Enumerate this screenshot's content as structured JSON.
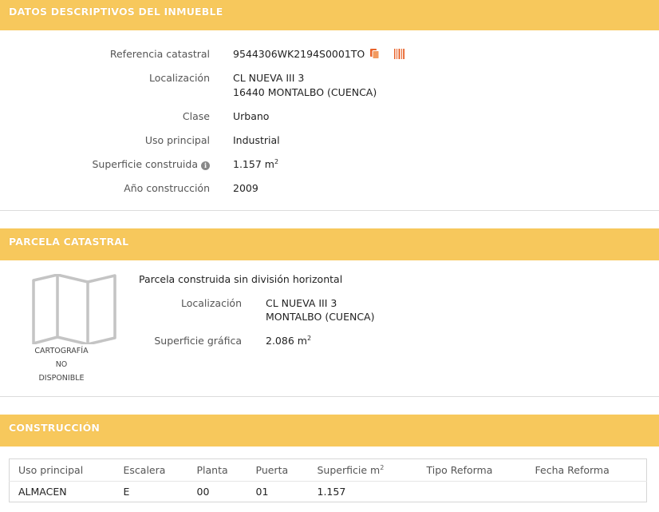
{
  "inmueble": {
    "header": "DATOS DESCRIPTIVOS DEL INMUEBLE",
    "referencia_label": "Referencia catastral",
    "referencia_value": "9544306WK2194S0001TO",
    "localizacion_label": "Localización",
    "localizacion_line1": "CL NUEVA III 3",
    "localizacion_line2": "16440 MONTALBO (CUENCA)",
    "clase_label": "Clase",
    "clase_value": "Urbano",
    "uso_label": "Uso principal",
    "uso_value": "Industrial",
    "superficie_label": "Superficie construida",
    "superficie_value": "1.157 m",
    "superficie_unit_sup": "2",
    "anio_label": "Año construcción",
    "anio_value": "2009"
  },
  "parcela": {
    "header": "PARCELA CATASTRAL",
    "description": "Parcela construida sin división horizontal",
    "localizacion_label": "Localización",
    "localizacion_line1": "CL NUEVA III 3",
    "localizacion_line2": "MONTALBO (CUENCA)",
    "superficie_label": "Superficie gráfica",
    "superficie_value": "2.086 m",
    "superficie_unit_sup": "2",
    "carto_line1": "CARTOGRAFÍA",
    "carto_line2": "NO",
    "carto_line3": "DISPONIBLE"
  },
  "construccion": {
    "header": "CONSTRUCCIÓN",
    "columns": [
      "Uso principal",
      "Escalera",
      "Planta",
      "Puerta",
      "Superficie m",
      "Tipo Reforma",
      "Fecha Reforma"
    ],
    "superficie_col_sup": "2",
    "rows": [
      [
        "ALMACEN",
        "E",
        "00",
        "01",
        "1.157",
        "",
        ""
      ]
    ]
  },
  "icons": {
    "copy": "copy-icon",
    "barcode": "barcode-icon",
    "info": "info-icon",
    "map": "folded-map-icon"
  },
  "colors": {
    "header_bg": "#f7c85c",
    "copy_icon": "#e8632b",
    "barcode_icon": "#e8632b"
  }
}
